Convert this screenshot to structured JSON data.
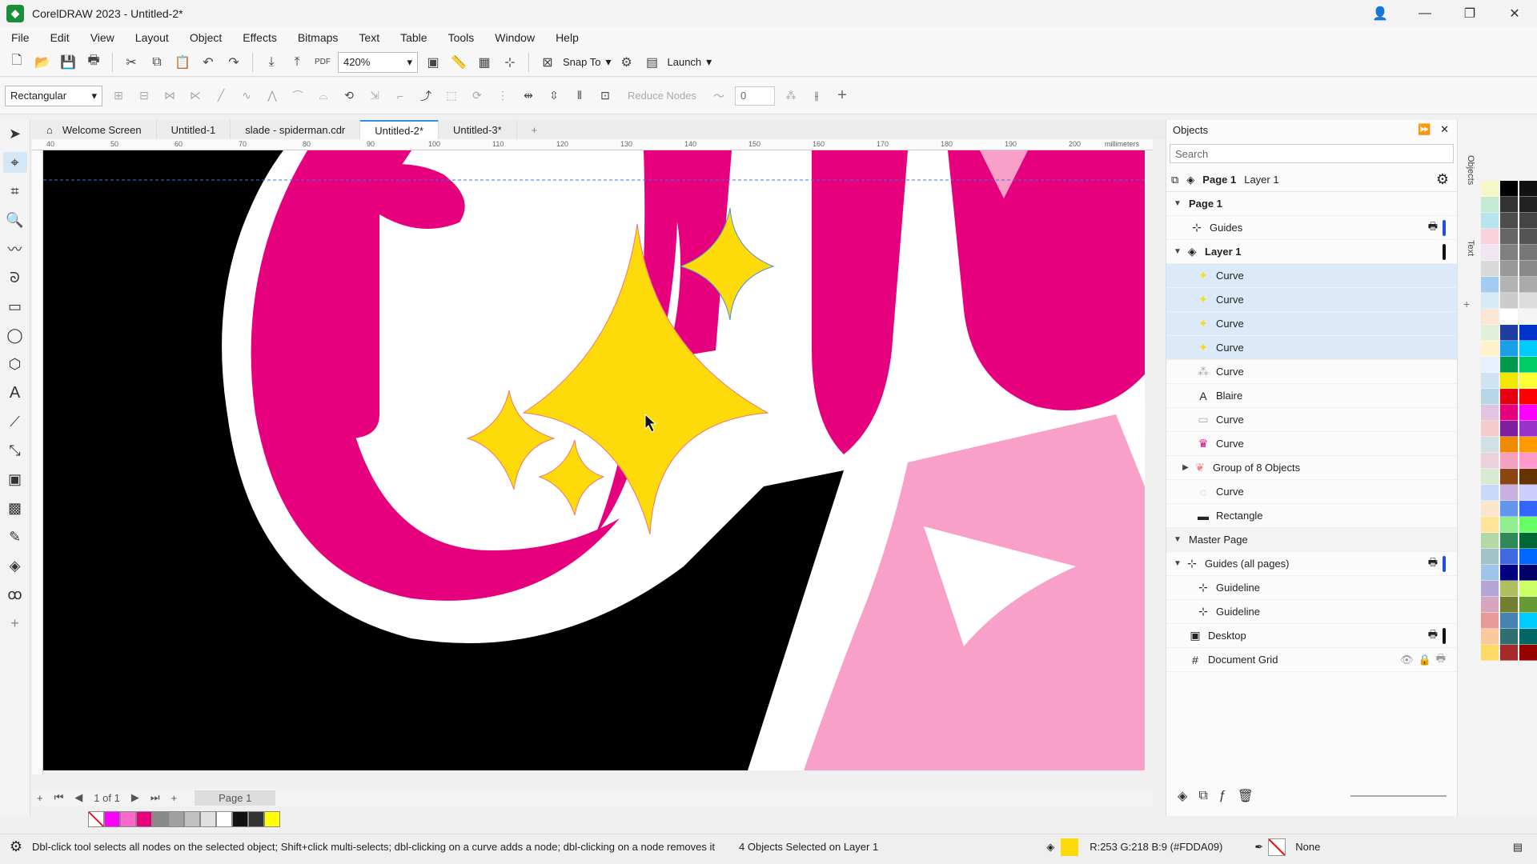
{
  "window": {
    "title": "CorelDRAW 2023 - Untitled-2*",
    "minimize": "—",
    "maximize": "❐",
    "close": "✕"
  },
  "menu": [
    "File",
    "Edit",
    "View",
    "Layout",
    "Object",
    "Effects",
    "Bitmaps",
    "Text",
    "Table",
    "Tools",
    "Window",
    "Help"
  ],
  "toolbar": {
    "zoom": "420%",
    "snap_to": "Snap To",
    "launch": "Launch",
    "pdf": "PDF"
  },
  "property_bar": {
    "shape": "Rectangular",
    "reduce_nodes": "Reduce Nodes",
    "smoothness": "0"
  },
  "doc_tabs": [
    "Welcome Screen",
    "Untitled-1",
    "slade - spiderman.cdr",
    "Untitled-2*",
    "Untitled-3*"
  ],
  "ruler": {
    "ticks": [
      "40",
      "50",
      "60",
      "70",
      "80",
      "90",
      "100",
      "110",
      "120",
      "130",
      "140",
      "150",
      "160",
      "170",
      "180",
      "190",
      "200"
    ],
    "unit": "millimeters"
  },
  "pager": {
    "page_count": "1 of 1",
    "page_tab": "Page 1"
  },
  "objects_panel": {
    "title": "Objects",
    "search_placeholder": "Search",
    "page": "Page 1",
    "layer": "Layer 1",
    "rows": [
      {
        "label": "Page 1",
        "icon": "chevron-down",
        "level": 0,
        "bold": true
      },
      {
        "label": "Guides",
        "icon": "guides-icon",
        "level": 1
      },
      {
        "label": "Layer 1",
        "icon": "layer-icon",
        "level": 1,
        "bold": true
      },
      {
        "label": "Curve",
        "icon": "star-icon",
        "level": 2,
        "selected": true
      },
      {
        "label": "Curve",
        "icon": "star-icon",
        "level": 2,
        "selected": true
      },
      {
        "label": "Curve",
        "icon": "star-icon",
        "level": 2,
        "selected": true
      },
      {
        "label": "Curve",
        "icon": "star-icon",
        "level": 2,
        "selected": true
      },
      {
        "label": "Curve",
        "icon": "curve-icon",
        "level": 2
      },
      {
        "label": "Blaire",
        "icon": "text-icon",
        "level": 2
      },
      {
        "label": "Curve",
        "icon": "curve-icon",
        "level": 2
      },
      {
        "label": "Curve",
        "icon": "crown-icon",
        "level": 2
      },
      {
        "label": "Group of 8 Objects",
        "icon": "group-icon",
        "level": 2
      },
      {
        "label": "Curve",
        "icon": "curve-icon",
        "level": 2
      },
      {
        "label": "Rectangle",
        "icon": "rectangle-icon",
        "level": 2
      },
      {
        "label": "Master Page",
        "icon": "chevron-down",
        "level": 0
      },
      {
        "label": "Guides (all pages)",
        "icon": "guides-icon",
        "level": 1
      },
      {
        "label": "Guideline",
        "icon": "guides-icon",
        "level": 2
      },
      {
        "label": "Guideline",
        "icon": "guides-icon",
        "level": 2
      },
      {
        "label": "Desktop",
        "icon": "desktop-icon",
        "level": 1
      },
      {
        "label": "Document Grid",
        "icon": "grid-icon",
        "level": 1
      }
    ]
  },
  "side_tabs": [
    "Objects",
    "Text"
  ],
  "status": {
    "hint": "Dbl-click tool selects all nodes on the selected object; Shift+click multi-selects; dbl-clicking on a curve adds a node; dbl-clicking on a node removes it",
    "selection": "4 Objects Selected on Layer 1",
    "fill": "R:253 G:218 B:9 (#FDDA09)",
    "outline": "None"
  },
  "colors": {
    "fill": "#FDDA09",
    "magenta": "#e6007e",
    "pink": "#f9a0c8",
    "black": "#000000"
  },
  "palette_bottom": [
    "#ff00ff",
    "#ff66cc",
    "#e6007e",
    "#888888",
    "#a0a0a0",
    "#c0c0c0",
    "#e0e0e0",
    "#ffffff",
    "#111111",
    "#333333",
    "#ffff00"
  ],
  "palette_right_a": [
    "#f6f7c9",
    "#c4ead3",
    "#b8e4f0",
    "#f7d1dc",
    "#f1e4f3",
    "#d9d9d9",
    "#a4ccf2",
    "#d6eaf8",
    "#fce4d6",
    "#e2efda",
    "#fff2cc",
    "#e6f0ff",
    "#cfe2f3",
    "#b7d7e8",
    "#e1c4e0",
    "#f4cccc",
    "#d0e0e3",
    "#ead1dc",
    "#d9ead3",
    "#c9daf8",
    "#fce5cd",
    "#ffe599",
    "#b6d7a8",
    "#a2c4c9",
    "#9fc5e8",
    "#b4a7d6",
    "#d5a6bd",
    "#ea9999",
    "#f9cb9c",
    "#ffd966"
  ],
  "palette_right_b": [
    "#000000",
    "#333333",
    "#4d4d4d",
    "#666666",
    "#808080",
    "#999999",
    "#b3b3b3",
    "#cccccc",
    "#ffffff",
    "#1f3fa0",
    "#1aa0e6",
    "#009a4e",
    "#f5e600",
    "#e60012",
    "#e6007e",
    "#7f1fa0",
    "#f08a00",
    "#f4a0c0",
    "#8b4513",
    "#c8b0e0",
    "#6495ed",
    "#90ee90",
    "#2e8b57",
    "#4169e1",
    "#000080",
    "#b0c060",
    "#708030",
    "#4682b4",
    "#2f6f6f",
    "#a52a2a"
  ],
  "palette_right_c": [
    "#111111",
    "#222222",
    "#444444",
    "#555555",
    "#777777",
    "#888888",
    "#aaaaaa",
    "#dddddd",
    "#f5f5f5",
    "#0033cc",
    "#00ccff",
    "#00cc66",
    "#ffff33",
    "#ff0000",
    "#ff00ff",
    "#9933cc",
    "#ff9900",
    "#ff99cc",
    "#663300",
    "#ccccff",
    "#3366ff",
    "#66ff66",
    "#006633",
    "#0066ff",
    "#000066",
    "#ccff66",
    "#669933",
    "#00ccff",
    "#006666",
    "#990000"
  ]
}
